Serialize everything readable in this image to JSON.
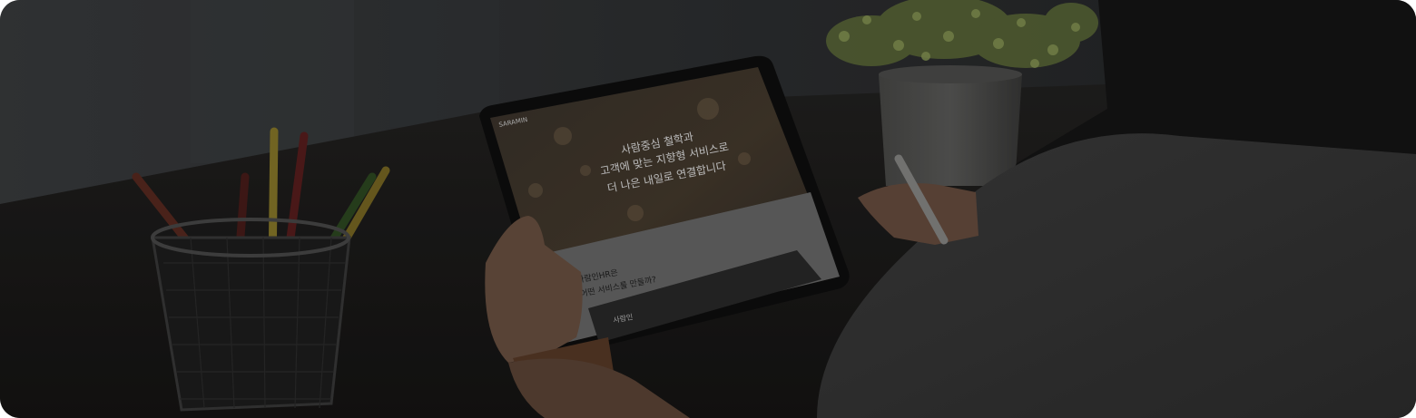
{
  "tablet_screen": {
    "logo": "SARAMIN",
    "hero_lines": [
      "사람중심 철학과",
      "고객에 맞는 지향형 서비스로",
      "더 나은 내일로 연결합니다"
    ],
    "section_heading_lines": [
      "사람인HR은",
      "어떤 서비스를 만들까?"
    ],
    "card_label": "사람인"
  },
  "colors": {
    "overlay": "#000000",
    "desk": "#1c1b1a",
    "plant": "#8a9a56"
  }
}
